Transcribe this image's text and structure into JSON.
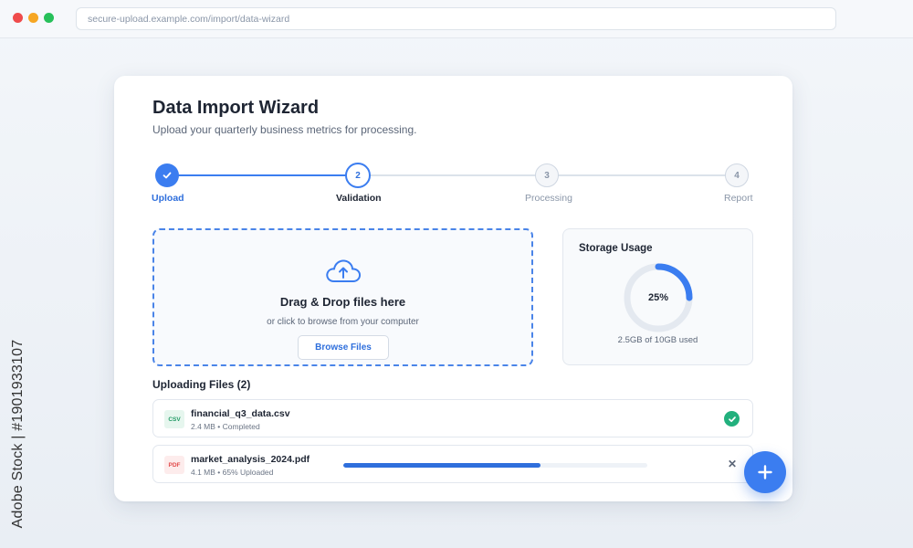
{
  "browser": {
    "url": "secure-upload.example.com/import/data-wizard",
    "dot_colors": [
      "#ef4b4b",
      "#f6a623",
      "#27c05a"
    ]
  },
  "watermark": {
    "side_text": "Adobe Stock | #1901933107"
  },
  "wizard": {
    "title": "Data Import Wizard",
    "subtitle": "Upload your quarterly business metrics for processing."
  },
  "stepper": {
    "steps": [
      {
        "number": "",
        "label": "Upload",
        "state": "completed"
      },
      {
        "number": "2",
        "label": "Validation",
        "state": "active"
      },
      {
        "number": "3",
        "label": "Processing",
        "state": "pending"
      },
      {
        "number": "4",
        "label": "Report",
        "state": "pending"
      }
    ],
    "accent": "#3b7df0"
  },
  "dropzone": {
    "icon": "cloud-upload-icon",
    "title": "Drag & Drop files here",
    "subtitle": "or click to browse from your computer",
    "button_label": "Browse Files"
  },
  "storage": {
    "title": "Storage Usage",
    "percent": 25,
    "percent_label": "25%",
    "caption": "2.5GB of 10GB used"
  },
  "uploads": {
    "title": "Uploading Files (2)",
    "files": [
      {
        "type": "CSV",
        "name": "financial_q3_data.csv",
        "meta": "2.4 MB • Completed",
        "status": "completed",
        "progress": 1.0
      },
      {
        "type": "PDF",
        "name": "market_analysis_2024.pdf",
        "meta": "4.1 MB • 65% Uploaded",
        "status": "uploading",
        "progress": 0.65
      }
    ]
  },
  "fab": {
    "icon": "plus-icon"
  }
}
